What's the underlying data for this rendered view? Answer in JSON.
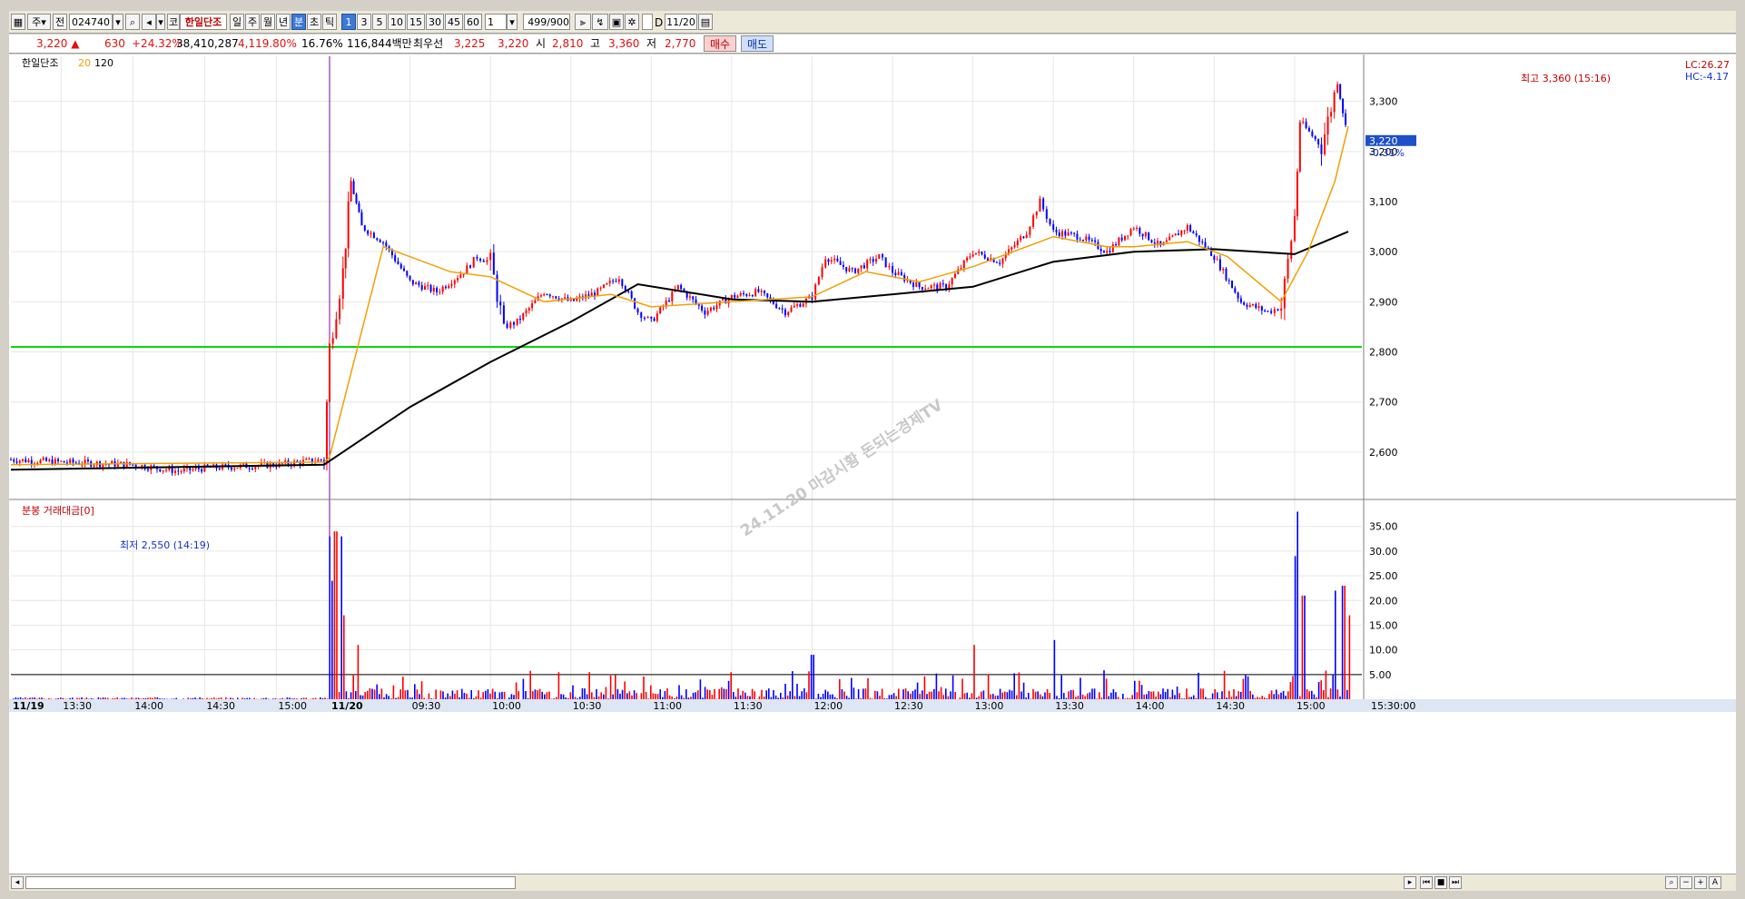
{
  "toolbar": {
    "btn_a": "주",
    "btn_b": "전",
    "stock_code": "024740",
    "market_tag": "코",
    "stock_name": "한일단조",
    "period_day": "일",
    "period_week": "주",
    "period_month": "월",
    "period_year": "년",
    "period_min": "분",
    "period_sec": "초",
    "period_tick": "틱",
    "intervals": [
      "1",
      "3",
      "5",
      "10",
      "15",
      "30",
      "45",
      "60"
    ],
    "interval_custom": "1",
    "count": "499",
    "count_total": "/900",
    "d_label": "D",
    "date": "11/20"
  },
  "quote": {
    "price": "3,220",
    "arrow": "▲",
    "change": "630",
    "change_pct": "+24.32%",
    "volume": "38,410,287",
    "volume_ratio": "4,119.80%",
    "turnover": "16.76%",
    "amount": "116,844백만",
    "best_label": "최우선",
    "best_ask": "3,225",
    "best_bid": "3,220",
    "open_label": "시",
    "open": "2,810",
    "high_label": "고",
    "high": "3,360",
    "low_label": "저",
    "low": "2,770",
    "buy_label": "매수",
    "sell_label": "매도"
  },
  "colors": {
    "up": "#ff0000",
    "down": "#0000ff",
    "ma20": "#f0a000",
    "ma120": "#000000",
    "base_line": "#00dd00",
    "current_price_bg": "#1e50c8"
  },
  "chart_data": [
    {
      "type": "candlestick",
      "legend_name": "한일단조",
      "ma_legend": [
        "20",
        "120"
      ],
      "right_labels": [
        "LC:26.27",
        "HC:-4.17"
      ],
      "y_ticks": [
        2600,
        2700,
        2800,
        2900,
        3000,
        3100,
        3200,
        3300
      ],
      "y_tick_labels": [
        "2,600",
        "2,700",
        "2,800",
        "2,900",
        "3,000",
        "3,100",
        "3,200",
        "3,300"
      ],
      "ylim": [
        2520,
        3390
      ],
      "current_price_label": "3,220",
      "current_change_label": "-0.31%",
      "base_line_price": 2810,
      "high_note": "최고 3,360 (15:16)",
      "low_note": "최저 2,550 (14:19)",
      "watermark": "24.11.20 마감시황 돈되는경제TV",
      "x_tick_labels": [
        "11/19",
        "13:30",
        "14:00",
        "14:30",
        "15:00",
        "11/20",
        "09:30",
        "10:00",
        "10:30",
        "11:00",
        "11:30",
        "12:00",
        "12:30",
        "13:00",
        "13:30",
        "14:00",
        "14:30",
        "15:00",
        "15:30:00"
      ],
      "price_path": [
        [
          "11/19 13:09",
          2585
        ],
        [
          "13:30",
          2580
        ],
        [
          "14:00",
          2575
        ],
        [
          "14:19",
          2562
        ],
        [
          "14:30",
          2568
        ],
        [
          "15:00",
          2575
        ],
        [
          "15:20",
          2585
        ],
        [
          "11/20 09:00",
          2810
        ],
        [
          "09:05",
          2960
        ],
        [
          "09:08",
          3140
        ],
        [
          "09:12",
          3050
        ],
        [
          "09:20",
          3020
        ],
        [
          "09:30",
          2940
        ],
        [
          "09:40",
          2920
        ],
        [
          "09:50",
          2960
        ],
        [
          "09:55",
          2990
        ],
        [
          "10:00",
          2980
        ],
        [
          "10:05",
          2850
        ],
        [
          "10:10",
          2860
        ],
        [
          "10:20",
          2920
        ],
        [
          "10:30",
          2900
        ],
        [
          "10:40",
          2920
        ],
        [
          "10:48",
          2950
        ],
        [
          "10:55",
          2880
        ],
        [
          "11:00",
          2860
        ],
        [
          "11:10",
          2930
        ],
        [
          "11:20",
          2880
        ],
        [
          "11:30",
          2910
        ],
        [
          "11:40",
          2920
        ],
        [
          "11:50",
          2880
        ],
        [
          "12:00",
          2910
        ],
        [
          "12:05",
          2990
        ],
        [
          "12:15",
          2960
        ],
        [
          "12:25",
          2990
        ],
        [
          "12:30",
          2960
        ],
        [
          "12:40",
          2930
        ],
        [
          "12:50",
          2930
        ],
        [
          "13:00",
          3000
        ],
        [
          "13:10",
          2980
        ],
        [
          "13:20",
          3040
        ],
        [
          "13:25",
          3100
        ],
        [
          "13:30",
          3040
        ],
        [
          "13:40",
          3030
        ],
        [
          "13:50",
          3000
        ],
        [
          "14:00",
          3050
        ],
        [
          "14:10",
          3010
        ],
        [
          "14:20",
          3050
        ],
        [
          "14:30",
          2990
        ],
        [
          "14:40",
          2900
        ],
        [
          "14:50",
          2880
        ],
        [
          "14:55",
          2890
        ],
        [
          "15:00",
          3070
        ],
        [
          "15:02",
          3260
        ],
        [
          "15:10",
          3210
        ],
        [
          "15:16",
          3340
        ],
        [
          "15:20",
          3220
        ]
      ],
      "ma20_path": [
        [
          "11/19 13:09",
          2575
        ],
        [
          "15:20",
          2580
        ],
        [
          "11/20 09:00",
          2590
        ],
        [
          "09:20",
          3010
        ],
        [
          "09:45",
          2960
        ],
        [
          "10:00",
          2950
        ],
        [
          "10:20",
          2900
        ],
        [
          "10:45",
          2915
        ],
        [
          "11:00",
          2890
        ],
        [
          "11:30",
          2900
        ],
        [
          "12:00",
          2910
        ],
        [
          "12:20",
          2960
        ],
        [
          "12:40",
          2940
        ],
        [
          "13:00",
          2970
        ],
        [
          "13:30",
          3030
        ],
        [
          "13:50",
          3010
        ],
        [
          "14:00",
          3010
        ],
        [
          "14:20",
          3020
        ],
        [
          "14:35",
          2990
        ],
        [
          "14:55",
          2900
        ],
        [
          "15:05",
          3000
        ],
        [
          "15:15",
          3140
        ],
        [
          "15:20",
          3250
        ]
      ],
      "ma120_path": [
        [
          "11/19 13:09",
          2565
        ],
        [
          "15:20",
          2575
        ],
        [
          "11/20 09:30",
          2690
        ],
        [
          "10:00",
          2780
        ],
        [
          "10:30",
          2860
        ],
        [
          "10:55",
          2935
        ],
        [
          "11:30",
          2905
        ],
        [
          "12:00",
          2900
        ],
        [
          "12:30",
          2915
        ],
        [
          "13:00",
          2930
        ],
        [
          "13:30",
          2980
        ],
        [
          "14:00",
          3000
        ],
        [
          "14:30",
          3005
        ],
        [
          "15:00",
          2995
        ],
        [
          "15:20",
          3040
        ]
      ]
    },
    {
      "type": "bar",
      "title": "분봉 거래대금[0]",
      "y_ticks": [
        5,
        10,
        15,
        20,
        25,
        30,
        35
      ],
      "y_tick_labels": [
        "5.00",
        "10.00",
        "15.00",
        "20.00",
        "25.00",
        "30.00",
        "35.00"
      ],
      "ylim": [
        0,
        39
      ],
      "reference_line": 5,
      "spikes": [
        {
          "time": "11/20 09:00",
          "value": 33
        },
        {
          "time": "09:01",
          "value": 24
        },
        {
          "time": "09:02",
          "value": 34
        },
        {
          "time": "09:04",
          "value": 33
        },
        {
          "time": "09:05",
          "value": 17
        },
        {
          "time": "09:10",
          "value": 11
        },
        {
          "time": "12:00",
          "value": 9
        },
        {
          "time": "13:00",
          "value": 11
        },
        {
          "time": "13:30",
          "value": 12
        },
        {
          "time": "15:00",
          "value": 29
        },
        {
          "time": "15:01",
          "value": 38
        },
        {
          "time": "15:03",
          "value": 21
        },
        {
          "time": "15:15",
          "value": 22
        },
        {
          "time": "15:18",
          "value": 23
        },
        {
          "time": "15:20",
          "value": 17
        }
      ]
    }
  ]
}
